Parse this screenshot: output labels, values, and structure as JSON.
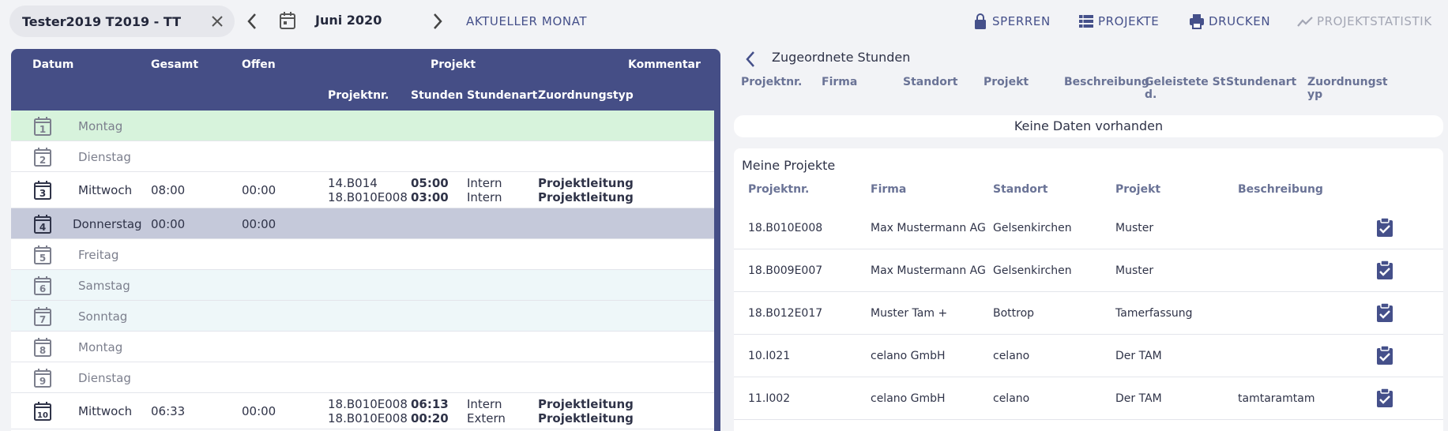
{
  "topbar": {
    "user": "Tester2019 T2019 - TT",
    "month": "Juni 2020",
    "current_month": "AKTUELLER MONAT",
    "lock": "SPERREN",
    "projects": "PROJEKTE",
    "print": "DRUCKEN",
    "stats": "PROJEKTSTATISTIK"
  },
  "left": {
    "headers": {
      "datum": "Datum",
      "gesamt": "Gesamt",
      "offen": "Offen",
      "projekt": "Projekt",
      "kommentar": "Kommentar",
      "projektnr": "Projektnr.",
      "stunden": "Stunden",
      "stundenart": "Stundenart",
      "zuordnungstyp": "Zuordnungstyp"
    },
    "rows": [
      {
        "day": "1",
        "name": "Montag"
      },
      {
        "day": "2",
        "name": "Dienstag"
      },
      {
        "day": "3",
        "name": "Mittwoch",
        "gesamt": "08:00",
        "offen": "00:00",
        "pnr1": "14.B014",
        "pnr2": "18.B010E008",
        "h1": "05:00",
        "h2": "03:00",
        "art1": "Intern",
        "art2": "Intern",
        "typ1": "Projektleitung",
        "typ2": "Projektleitung"
      },
      {
        "day": "4",
        "name": "Donnerstag",
        "gesamt": "00:00",
        "offen": "00:00"
      },
      {
        "day": "5",
        "name": "Freitag"
      },
      {
        "day": "6",
        "name": "Samstag"
      },
      {
        "day": "7",
        "name": "Sonntag"
      },
      {
        "day": "8",
        "name": "Montag"
      },
      {
        "day": "9",
        "name": "Dienstag"
      },
      {
        "day": "10",
        "name": "Mittwoch",
        "gesamt": "06:33",
        "offen": "00:00",
        "pnr1": "18.B010E008",
        "pnr2": "18.B010E008",
        "h1": "06:13",
        "h2": "00:20",
        "art1": "Intern",
        "art2": "Extern",
        "typ1": "Projektleitung",
        "typ2": "Projektleitung"
      }
    ]
  },
  "right": {
    "title": "Zugeordnete Stunden",
    "headers": {
      "projektnr": "Projektnr.",
      "firma": "Firma",
      "standort": "Standort",
      "projekt": "Projekt",
      "beschreibung": "Beschreibung",
      "geleistete_a": "Geleistete St",
      "geleistete_b": "d.",
      "stundenart": "Stundenart",
      "zuordnung_a": "Zuordnungst",
      "zuordnung_b": "yp"
    },
    "nodata": "Keine Daten vorhanden"
  },
  "projects": {
    "title": "Meine Projekte",
    "headers": {
      "projektnr": "Projektnr.",
      "firma": "Firma",
      "standort": "Standort",
      "projekt": "Projekt",
      "beschreibung": "Beschreibung"
    },
    "rows": [
      {
        "nr": "18.B010E008",
        "firma": "Max Mustermann AG",
        "standort": "Gelsenkirchen",
        "projekt": "Muster",
        "beschreibung": ""
      },
      {
        "nr": "18.B009E007",
        "firma": "Max Mustermann AG",
        "standort": "Gelsenkirchen",
        "projekt": "Muster",
        "beschreibung": ""
      },
      {
        "nr": "18.B012E017",
        "firma": "Muster Tam +",
        "standort": "Bottrop",
        "projekt": "Tamerfassung",
        "beschreibung": ""
      },
      {
        "nr": "10.I021",
        "firma": "celano GmbH",
        "standort": "celano",
        "projekt": "Der TAM",
        "beschreibung": ""
      },
      {
        "nr": "11.I002",
        "firma": "celano GmbH",
        "standort": "celano",
        "projekt": "Der TAM",
        "beschreibung": "tamtaramtam"
      }
    ]
  },
  "colors": {
    "accent": "#454e86",
    "link": "#45508a",
    "selected_row": "#c5c9da",
    "today_row": "#d7f3dc",
    "weekend_row": "#eef7f9"
  }
}
